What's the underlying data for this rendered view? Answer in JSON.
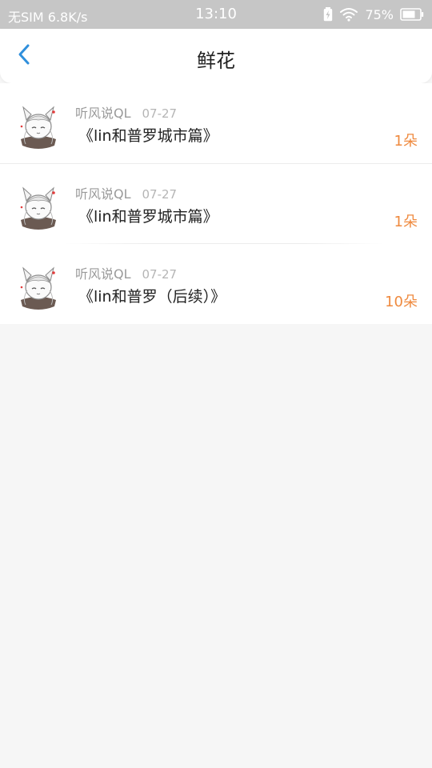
{
  "status_bar": {
    "carrier": "无SIM",
    "speed": "6.8K/s",
    "time": "13:10",
    "battery_percent": "75%",
    "icons": [
      "battery-charging-icon",
      "wifi-icon",
      "battery-icon"
    ]
  },
  "nav": {
    "back_icon": "chevron-left-icon",
    "title": "鲜花"
  },
  "items": [
    {
      "author": "听风说QL",
      "date": "07-27",
      "title": "《lin和普罗城市篇》",
      "count": "1朵"
    },
    {
      "author": "听风说QL",
      "date": "07-27",
      "title": "《lin和普罗城市篇》",
      "count": "1朵"
    },
    {
      "author": "听风说QL",
      "date": "07-27",
      "title": "《lin和普罗（后续）》",
      "count": "10朵"
    }
  ],
  "colors": {
    "status_bar_bg": "#c6c6c6",
    "accent_blue": "#2f8fdc",
    "count_orange": "#ef8a3f",
    "page_bg": "#f6f6f6"
  }
}
